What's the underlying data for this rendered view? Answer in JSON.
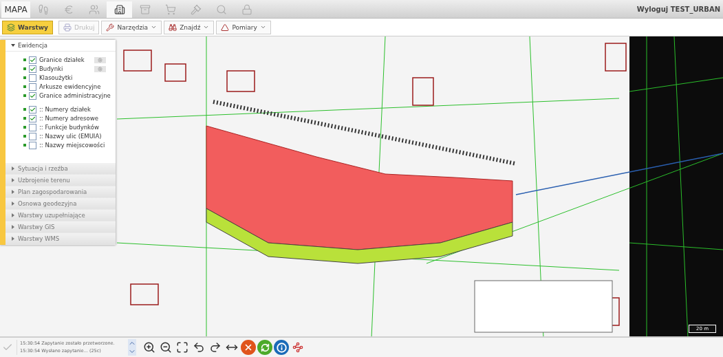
{
  "tabs": [
    {
      "kind": "text",
      "label": "MAPA",
      "selected": true
    },
    {
      "kind": "icon",
      "selected": false
    },
    {
      "kind": "icon",
      "selected": false
    },
    {
      "kind": "icon",
      "selected": false
    },
    {
      "kind": "icon",
      "selected": true
    },
    {
      "kind": "icon",
      "selected": false
    },
    {
      "kind": "icon",
      "selected": false
    },
    {
      "kind": "icon",
      "selected": false
    },
    {
      "kind": "icon",
      "selected": false
    },
    {
      "kind": "icon",
      "selected": false
    }
  ],
  "user_link": "Wyloguj TEST_URBAN",
  "toolbar": [
    {
      "label": "Warstwy",
      "active": true,
      "disabled": false,
      "dropdown": false
    },
    {
      "label": "Drukuj",
      "active": false,
      "disabled": true,
      "dropdown": false
    },
    {
      "label": "Narzędzia",
      "active": false,
      "disabled": false,
      "dropdown": true
    },
    {
      "label": "Znajdź",
      "active": false,
      "disabled": false,
      "dropdown": true
    },
    {
      "label": "Pomiary",
      "active": false,
      "disabled": false,
      "dropdown": true
    }
  ],
  "layer_panel": {
    "groups": [
      {
        "title": "Ewidencja",
        "expanded": true,
        "sections": [
          [
            {
              "label": "Granice działek",
              "checked": true,
              "settings": true
            },
            {
              "label": "Budynki",
              "checked": true,
              "settings": true
            },
            {
              "label": "Klasoużytki",
              "checked": false,
              "settings": false
            },
            {
              "label": "Arkusze ewidencyjne",
              "checked": false,
              "settings": false
            },
            {
              "label": "Granice administracyjne",
              "checked": true,
              "settings": false
            }
          ],
          [
            {
              "label": ":: Numery działek",
              "checked": true,
              "settings": false
            },
            {
              "label": ":: Numery adresowe",
              "checked": true,
              "settings": false
            },
            {
              "label": ":: Funkcje budynków",
              "checked": false,
              "settings": false
            },
            {
              "label": ":: Nazwy ulic (EMUIA)",
              "checked": false,
              "settings": false
            },
            {
              "label": ":: Nazwy miejscowości",
              "checked": false,
              "settings": false
            }
          ]
        ]
      },
      {
        "title": "Sytuacja i rzeźba",
        "expanded": false
      },
      {
        "title": "Uzbrojenie terenu",
        "expanded": false
      },
      {
        "title": "Plan zagospodarowania",
        "expanded": false
      },
      {
        "title": "Osnowa geodezyjna",
        "expanded": false
      },
      {
        "title": "Warstwy uzupełniające",
        "expanded": false
      },
      {
        "title": "Warstwy GIS",
        "expanded": false
      },
      {
        "title": "Warstwy WMS",
        "expanded": false
      }
    ]
  },
  "scale_bar": "20 m",
  "log": [
    "15:30:54 Zapytanie zostało przetworzone.",
    "15:30:54 Wysłano zapytanie... (25c)"
  ]
}
